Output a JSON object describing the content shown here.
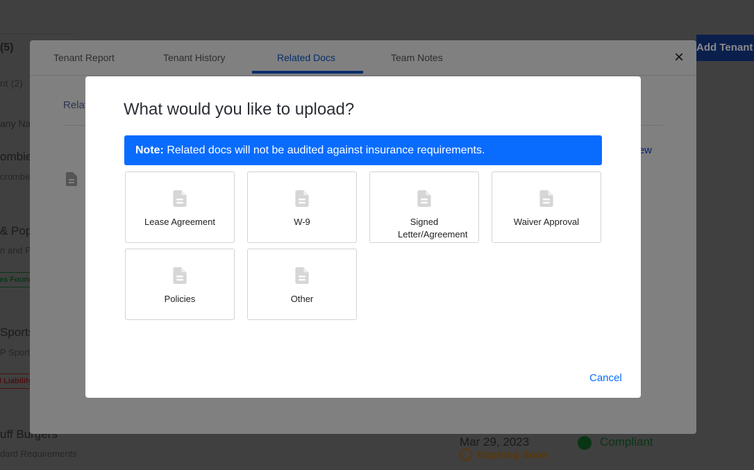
{
  "background": {
    "left_items": [
      "(5)",
      "nt (2)",
      "any Na",
      "ombie",
      "crombie",
      "& Pop",
      "n and P",
      "es Found",
      "Sports",
      "P Sports",
      "l Liability",
      "uff Burgers",
      "dard Requirements"
    ],
    "add_tenant": "Add Tenant",
    "date": "Mar 29, 2023",
    "status_compliant": "Compliant",
    "status_expiring": "Expiring Soon"
  },
  "modal": {
    "tabs": [
      {
        "label": "Tenant Report"
      },
      {
        "label": "Tenant History"
      },
      {
        "label": "Related Docs",
        "active": true
      },
      {
        "label": "Team Notes"
      }
    ],
    "section_label": "Relat",
    "view_link": "ew",
    "close": "×"
  },
  "dialog": {
    "title": "What would you like to upload?",
    "note_bold": "Note:",
    "note_text": " Related docs will not be audited against insurance requirements.",
    "options": [
      {
        "label": "Lease Agreement",
        "icon": "document-icon"
      },
      {
        "label": "W-9",
        "icon": "document-icon"
      },
      {
        "label": "Signed Letter/Agreement",
        "icon": "document-icon"
      },
      {
        "label": "Waiver Approval",
        "icon": "document-icon"
      },
      {
        "label": "Policies",
        "icon": "document-icon"
      },
      {
        "label": "Other",
        "icon": "document-icon"
      }
    ],
    "cancel": "Cancel"
  },
  "colors": {
    "accent": "#0a6cff",
    "tab_active": "#0a5bd6",
    "success": "#1a9a3a",
    "danger": "#c0282d",
    "warning": "#e0881a"
  }
}
